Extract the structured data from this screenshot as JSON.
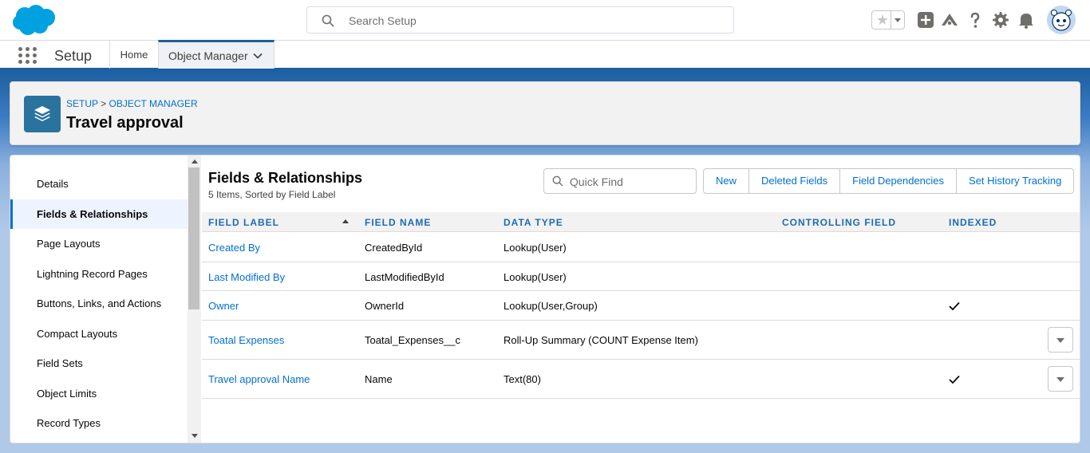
{
  "header": {
    "search_placeholder": "Search Setup"
  },
  "context_bar": {
    "app_name": "Setup",
    "nav_home": "Home",
    "nav_object_manager": "Object Manager"
  },
  "page_header": {
    "breadcrumb_setup": "SETUP",
    "breadcrumb_sep": ">",
    "breadcrumb_object_manager": "OBJECT MANAGER",
    "title": "Travel approval"
  },
  "sidebar": {
    "items": [
      {
        "label": "Details"
      },
      {
        "label": "Fields & Relationships",
        "active": true
      },
      {
        "label": "Page Layouts"
      },
      {
        "label": "Lightning Record Pages"
      },
      {
        "label": "Buttons, Links, and Actions"
      },
      {
        "label": "Compact Layouts"
      },
      {
        "label": "Field Sets"
      },
      {
        "label": "Object Limits"
      },
      {
        "label": "Record Types"
      }
    ]
  },
  "section": {
    "title": "Fields & Relationships",
    "subtitle": "5 Items, Sorted by Field Label",
    "quick_find_placeholder": "Quick Find",
    "buttons": [
      "New",
      "Deleted Fields",
      "Field Dependencies",
      "Set History Tracking"
    ]
  },
  "table": {
    "columns": [
      "FIELD LABEL",
      "FIELD NAME",
      "DATA TYPE",
      "CONTROLLING FIELD",
      "INDEXED"
    ],
    "rows": [
      {
        "label": "Created By",
        "name": "CreatedById",
        "type": "Lookup(User)",
        "controlling": "",
        "indexed": false,
        "menu": false
      },
      {
        "label": "Last Modified By",
        "name": "LastModifiedById",
        "type": "Lookup(User)",
        "controlling": "",
        "indexed": false,
        "menu": false
      },
      {
        "label": "Owner",
        "name": "OwnerId",
        "type": "Lookup(User,Group)",
        "controlling": "",
        "indexed": true,
        "menu": false
      },
      {
        "label": "Toatal Expenses",
        "name": "Toatal_Expenses__c",
        "type": "Roll-Up Summary (COUNT Expense Item)",
        "controlling": "",
        "indexed": false,
        "menu": true
      },
      {
        "label": "Travel approval Name",
        "name": "Name",
        "type": "Text(80)",
        "controlling": "",
        "indexed": true,
        "menu": true
      }
    ]
  },
  "colors": {
    "brand": "#00a1e0",
    "link": "#0070d2",
    "header_blue": "#1b5f9e",
    "object_icon": "#2a739e"
  }
}
